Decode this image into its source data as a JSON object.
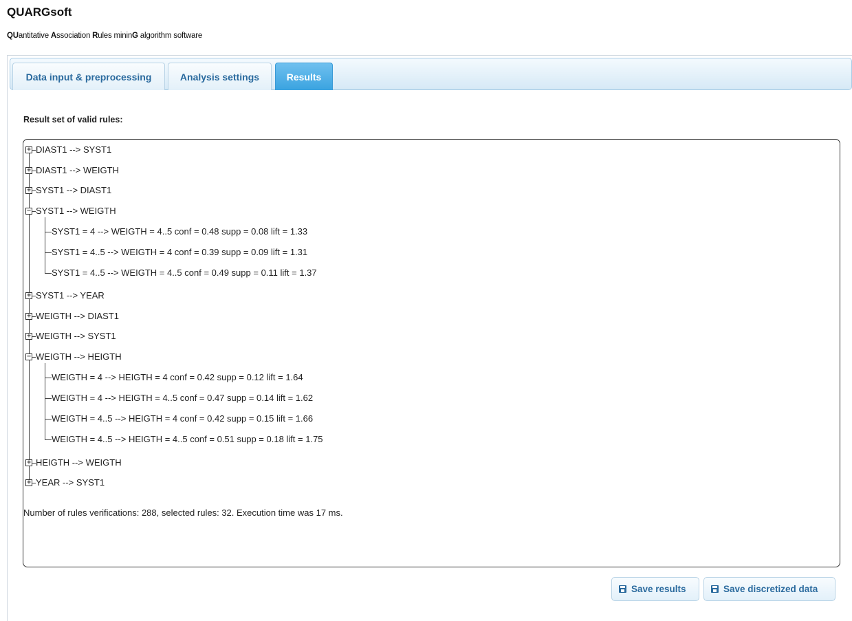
{
  "app": {
    "title": "QUARGsoft",
    "subtitle_parts": [
      {
        "text": "QU",
        "bold": true
      },
      {
        "text": "antitative ",
        "bold": false
      },
      {
        "text": "A",
        "bold": true
      },
      {
        "text": "ssociation ",
        "bold": false
      },
      {
        "text": "R",
        "bold": true
      },
      {
        "text": "ules minin",
        "bold": false
      },
      {
        "text": "G",
        "bold": true
      },
      {
        "text": " algorithm software",
        "bold": false
      }
    ]
  },
  "tabs": [
    {
      "label": "Data input & preprocessing",
      "active": false
    },
    {
      "label": "Analysis settings",
      "active": false
    },
    {
      "label": "Results",
      "active": true
    }
  ],
  "results": {
    "panel_label": "Result set of valid rules:",
    "tree": [
      {
        "label": "DIAST1 --> SYST1",
        "expanded": false,
        "children": []
      },
      {
        "label": "DIAST1 --> WEIGTH",
        "expanded": false,
        "children": []
      },
      {
        "label": "SYST1 --> DIAST1",
        "expanded": false,
        "children": []
      },
      {
        "label": "SYST1 --> WEIGTH",
        "expanded": true,
        "children": [
          "SYST1 = 4 --> WEIGTH = 4..5 conf = 0.48 supp = 0.08 lift = 1.33",
          "SYST1 = 4..5 --> WEIGTH = 4 conf = 0.39 supp = 0.09 lift = 1.31",
          "SYST1 = 4..5 --> WEIGTH = 4..5 conf = 0.49 supp = 0.11 lift = 1.37"
        ]
      },
      {
        "label": "SYST1 --> YEAR",
        "expanded": false,
        "children": []
      },
      {
        "label": "WEIGTH --> DIAST1",
        "expanded": false,
        "children": []
      },
      {
        "label": "WEIGTH --> SYST1",
        "expanded": false,
        "children": []
      },
      {
        "label": "WEIGTH --> HEIGTH",
        "expanded": true,
        "children": [
          "WEIGTH = 4 --> HEIGTH = 4 conf = 0.42 supp = 0.12 lift = 1.64",
          "WEIGTH = 4 --> HEIGTH = 4..5 conf = 0.47 supp = 0.14 lift = 1.62",
          "WEIGTH = 4..5 --> HEIGTH = 4 conf = 0.42 supp = 0.15 lift = 1.66",
          "WEIGTH = 4..5 --> HEIGTH = 4..5 conf = 0.51 supp = 0.18 lift = 1.75"
        ]
      },
      {
        "label": "HEIGTH --> WEIGTH",
        "expanded": false,
        "children": []
      },
      {
        "label": "YEAR --> SYST1",
        "expanded": false,
        "children": []
      }
    ],
    "summary": "Number of rules verifications: 288, selected rules: 32. Execution time was 17 ms."
  },
  "buttons": {
    "save_results": "Save results",
    "save_discretized": "Save discretized data",
    "icon": "save-disk-icon"
  },
  "colors": {
    "accent": "#3aa3e0",
    "tab_text": "#2a6a9e",
    "tab_bar_border": "#a8cce6"
  }
}
